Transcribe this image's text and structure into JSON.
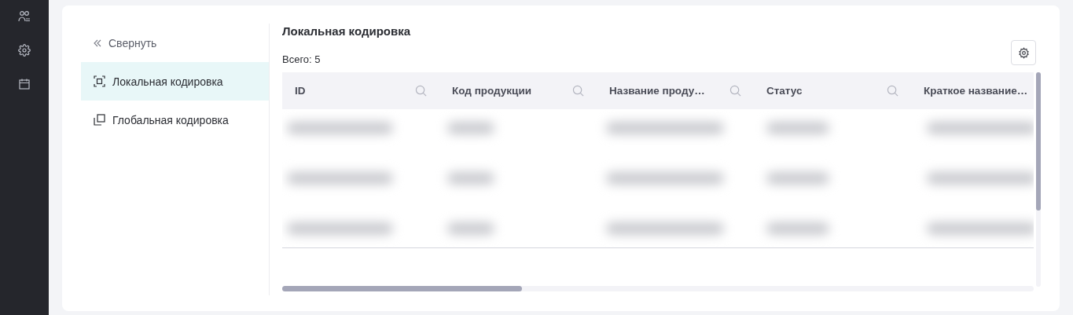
{
  "sidebar": {
    "items": [
      {
        "kind": "users",
        "selected": false
      },
      {
        "kind": "settings",
        "selected": false
      },
      {
        "kind": "calendar",
        "selected": false
      }
    ]
  },
  "nav": {
    "collapse": {
      "label": "Свернуть"
    },
    "items": [
      {
        "label": "Локальная кодировка",
        "kind": "local",
        "selected": true
      },
      {
        "label": "Глобальная кодировка",
        "kind": "global",
        "selected": false
      }
    ]
  },
  "content": {
    "title": "Локальная кодировка",
    "total": "Всего: 5",
    "table": {
      "columns": [
        "ID",
        "Код продукции",
        "Название проду…",
        "Статус",
        "Краткое название…"
      ],
      "rows": [
        {
          "kind": "blurred"
        },
        {
          "kind": "blurred"
        },
        {
          "kind": "blurred"
        }
      ]
    }
  }
}
